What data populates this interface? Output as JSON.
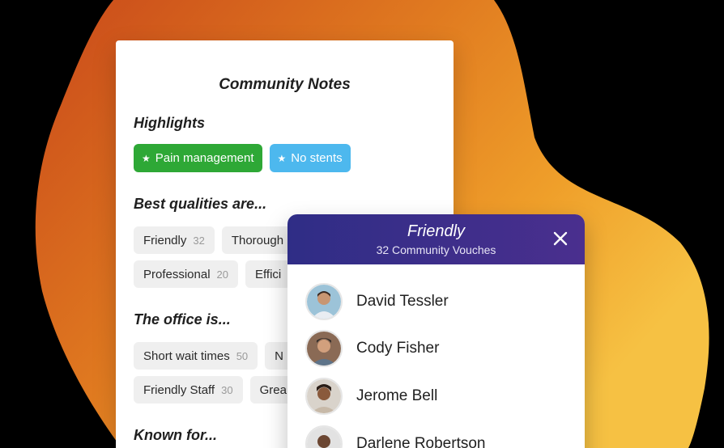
{
  "colors": {
    "background": "#000000",
    "blob_start": "#c9491a",
    "blob_mid": "#e58a22",
    "blob_end": "#f6c143",
    "highlight_green": "#2ea836",
    "highlight_blue": "#4db8ee",
    "popup_header": "#33308a"
  },
  "notes": {
    "title": "Community Notes",
    "highlights": {
      "title": "Highlights",
      "chips": [
        {
          "label": "Pain management",
          "icon": "star-icon"
        },
        {
          "label": "No stents",
          "icon": "star-icon"
        }
      ]
    },
    "qualities": {
      "title": "Best qualities are...",
      "row1": [
        {
          "label": "Friendly",
          "count": "32"
        },
        {
          "label": "Thorough",
          "count": ""
        }
      ],
      "row2": [
        {
          "label": "Professional",
          "count": "20"
        },
        {
          "label": "Effici",
          "count": ""
        }
      ]
    },
    "office": {
      "title": "The office is...",
      "row1": [
        {
          "label": "Short wait times",
          "count": "50"
        },
        {
          "label": "N",
          "count": ""
        }
      ],
      "row2": [
        {
          "label": "Friendly Staff",
          "count": "30"
        },
        {
          "label": "Grea",
          "count": ""
        }
      ]
    },
    "known_for": {
      "title": "Known for..."
    }
  },
  "popup": {
    "title": "Friendly",
    "subtitle": "32 Community Vouches",
    "close_icon": "close-icon",
    "people": [
      {
        "name": "David Tessler"
      },
      {
        "name": "Cody Fisher"
      },
      {
        "name": "Jerome Bell"
      },
      {
        "name": "Darlene Robertson"
      }
    ]
  }
}
